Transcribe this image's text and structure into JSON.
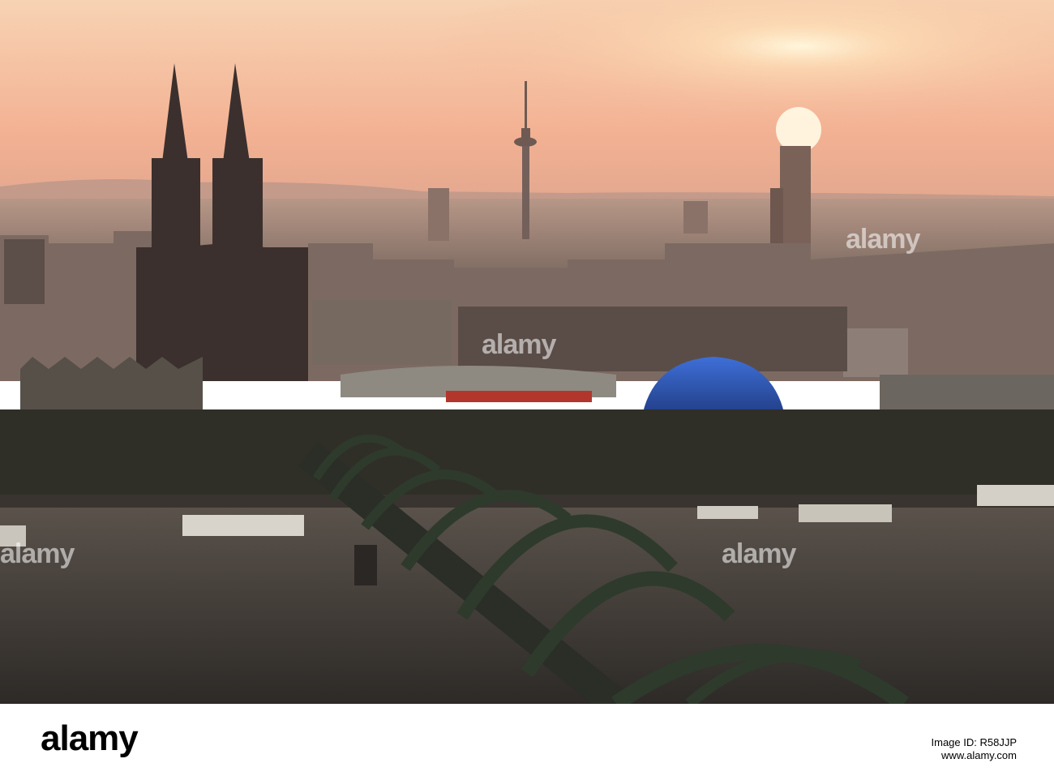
{
  "watermark": {
    "text": "alamy"
  },
  "footer": {
    "logo": "alamy",
    "image_id_label": "Image ID: R58JJP",
    "site": "www.alamy.com"
  },
  "colors": {
    "sky_top": "#f4c9a6",
    "sky_mid": "#f2a98a",
    "sky_horizon": "#d9a08a",
    "sun": "#fff3d6",
    "city_far": "#8f7e74",
    "city_near": "#3f3834",
    "cathedral": "#3a302e",
    "river": "#4b4540",
    "bridge": "#2f3a2f",
    "dome": "#2b4fa8",
    "train": "#b0302a"
  }
}
